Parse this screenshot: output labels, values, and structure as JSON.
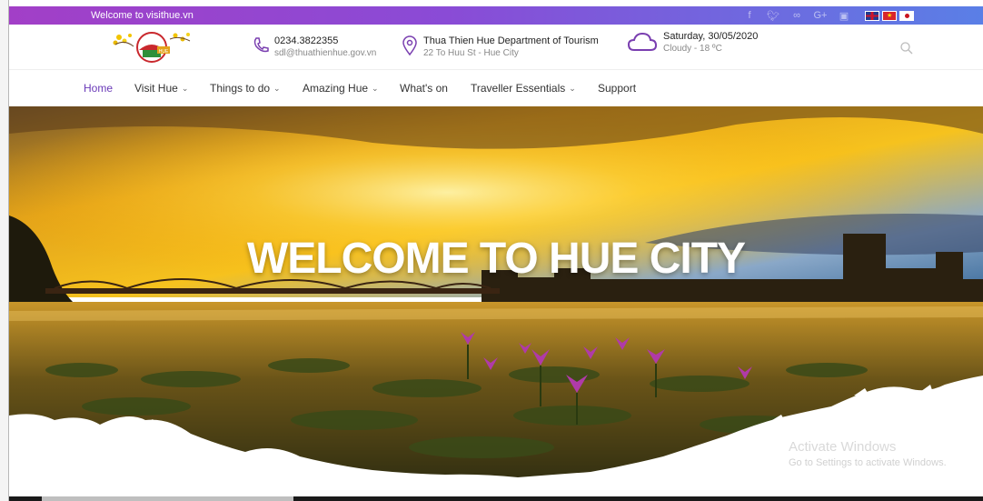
{
  "topbar": {
    "welcome": "Welcome to visithue.vn",
    "social_icons": [
      "facebook-icon",
      "twitter-icon",
      "tripadvisor-icon",
      "google-plus-icon",
      "youtube-icon"
    ],
    "languages": [
      "en",
      "vi",
      "ja"
    ]
  },
  "header": {
    "logo_text": "HUE",
    "phone": "0234.3822355",
    "email": "sdl@thuathienhue.gov.vn",
    "org": "Thua Thien Hue Department of Tourism",
    "address": "22 To Huu St - Hue City",
    "date": "Saturday, 30/05/2020",
    "weather": "Cloudy - 18 ºC"
  },
  "nav": {
    "items": [
      {
        "label": "Home",
        "dropdown": false,
        "active": true
      },
      {
        "label": "Visit Hue",
        "dropdown": true,
        "active": false
      },
      {
        "label": "Things to do",
        "dropdown": true,
        "active": false
      },
      {
        "label": "Amazing Hue",
        "dropdown": true,
        "active": false
      },
      {
        "label": "What's on",
        "dropdown": false,
        "active": false
      },
      {
        "label": "Traveller Essentials",
        "dropdown": true,
        "active": false
      },
      {
        "label": "Support",
        "dropdown": false,
        "active": false
      }
    ]
  },
  "hero": {
    "title": "WELCOME TO HUE CITY"
  },
  "watermark": {
    "line1": "Activate Windows",
    "line2": "Go to Settings to activate Windows."
  },
  "colors": {
    "accent": "#6a3ab8",
    "topbar_start": "#a23fc7",
    "topbar_end": "#5a7fe6"
  }
}
